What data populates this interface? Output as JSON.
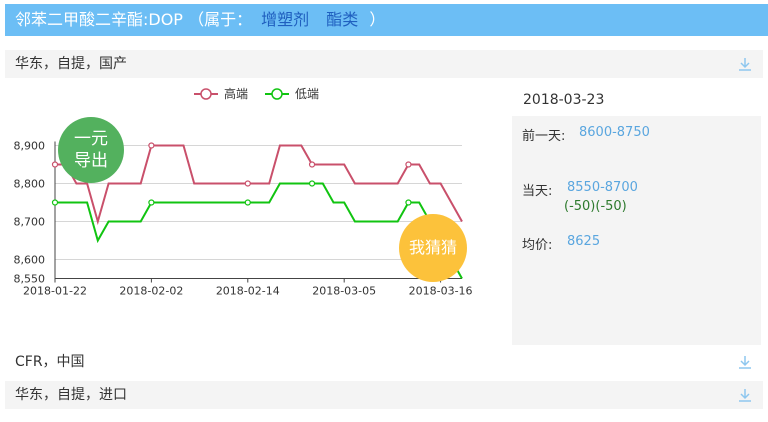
{
  "header": {
    "title": "邻苯二甲酸二辛酯:DOP",
    "belongs_prefix": "（属于：",
    "category_1": "增塑剂",
    "category_2": "酯类",
    "belongs_suffix": "）"
  },
  "rows": {
    "top": "华东，自提，国产",
    "cfr": "CFR，中国",
    "bottom": "华东，自提，进口"
  },
  "side": {
    "date": "2018-03-23",
    "prev_label": "前一天:",
    "prev_value": "8600-8750",
    "today_label": "当天:",
    "today_value": "8550-8700",
    "today_change": "(-50)(-50)",
    "avg_label": "均价:",
    "avg_value": "8625"
  },
  "bubbles": {
    "export_line1": "一元",
    "export_line2": "导出",
    "guess": "我猜猜"
  },
  "colors": {
    "high": "#c9506b",
    "low": "#11c411",
    "accent": "#6cbef5"
  },
  "chart_data": {
    "type": "line",
    "x_tick_labels": [
      "2018-01-22",
      "2018-02-02",
      "2018-02-14",
      "2018-03-05",
      "2018-03-16"
    ],
    "y_tick_labels": [
      "8,550",
      "8,600",
      "8,700",
      "8,800",
      "8,900"
    ],
    "ylim": [
      8550,
      8950
    ],
    "legend": [
      "高端",
      "低端"
    ],
    "legend_position": "top-center",
    "grid": true,
    "series": [
      {
        "name": "高端",
        "color": "#c9506b",
        "values": [
          8850,
          8850,
          8800,
          8800,
          8700,
          8800,
          8800,
          8800,
          8800,
          8900,
          8900,
          8900,
          8900,
          8800,
          8800,
          8800,
          8800,
          8800,
          8800,
          8800,
          8800,
          8900,
          8900,
          8900,
          8850,
          8850,
          8850,
          8850,
          8800,
          8800,
          8800,
          8800,
          8800,
          8850,
          8850,
          8800,
          8800,
          8750,
          8700
        ]
      },
      {
        "name": "低端",
        "color": "#11c411",
        "values": [
          8750,
          8750,
          8750,
          8750,
          8650,
          8700,
          8700,
          8700,
          8700,
          8750,
          8750,
          8750,
          8750,
          8750,
          8750,
          8750,
          8750,
          8750,
          8750,
          8750,
          8750,
          8800,
          8800,
          8800,
          8800,
          8800,
          8750,
          8750,
          8700,
          8700,
          8700,
          8700,
          8700,
          8750,
          8750,
          8700,
          8650,
          8600,
          8550
        ]
      }
    ],
    "markers_at": [
      0,
      9,
      18,
      24,
      33
    ]
  }
}
